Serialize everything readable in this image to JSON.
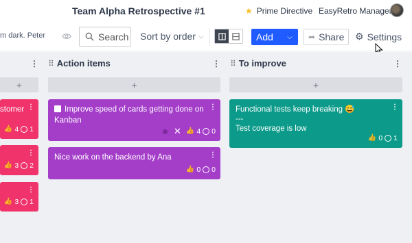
{
  "header": {
    "board_title": "Team Alpha Retrospective #1",
    "prime_directive": "Prime Directive",
    "user_name": "EasyRetro Manager",
    "star_color": "#f6c026"
  },
  "toolbar": {
    "filter_text": "m dark. Peter",
    "search_placeholder": "Search",
    "sort_label": "Sort by order",
    "add_label": "Add",
    "share_label": "Share",
    "settings_label": "Settings",
    "accent": "#1f5bff"
  },
  "columns": [
    {
      "title": "",
      "cards": [
        {
          "text": "stomer",
          "votes": "4",
          "comments": "1"
        },
        {
          "text": "",
          "votes": "3",
          "comments": "2"
        },
        {
          "text": "",
          "votes": "3",
          "comments": "1"
        }
      ]
    },
    {
      "title": "Action items",
      "cards": [
        {
          "text": "Improve speed of cards getting done on Kanban",
          "votes": "4",
          "comments": "0"
        },
        {
          "text": "Nice work on the backend by Ana",
          "votes": "0",
          "comments": "0"
        }
      ]
    },
    {
      "title": "To improve",
      "cards": [
        {
          "line1": "Functional tests keep breaking 😅",
          "line2": "---",
          "line3": "Test coverage is low",
          "votes": "0",
          "comments": "1"
        }
      ]
    }
  ],
  "colors": {
    "red": "#f0336b",
    "purple": "#a43ec9",
    "teal": "#0c9b8a"
  }
}
